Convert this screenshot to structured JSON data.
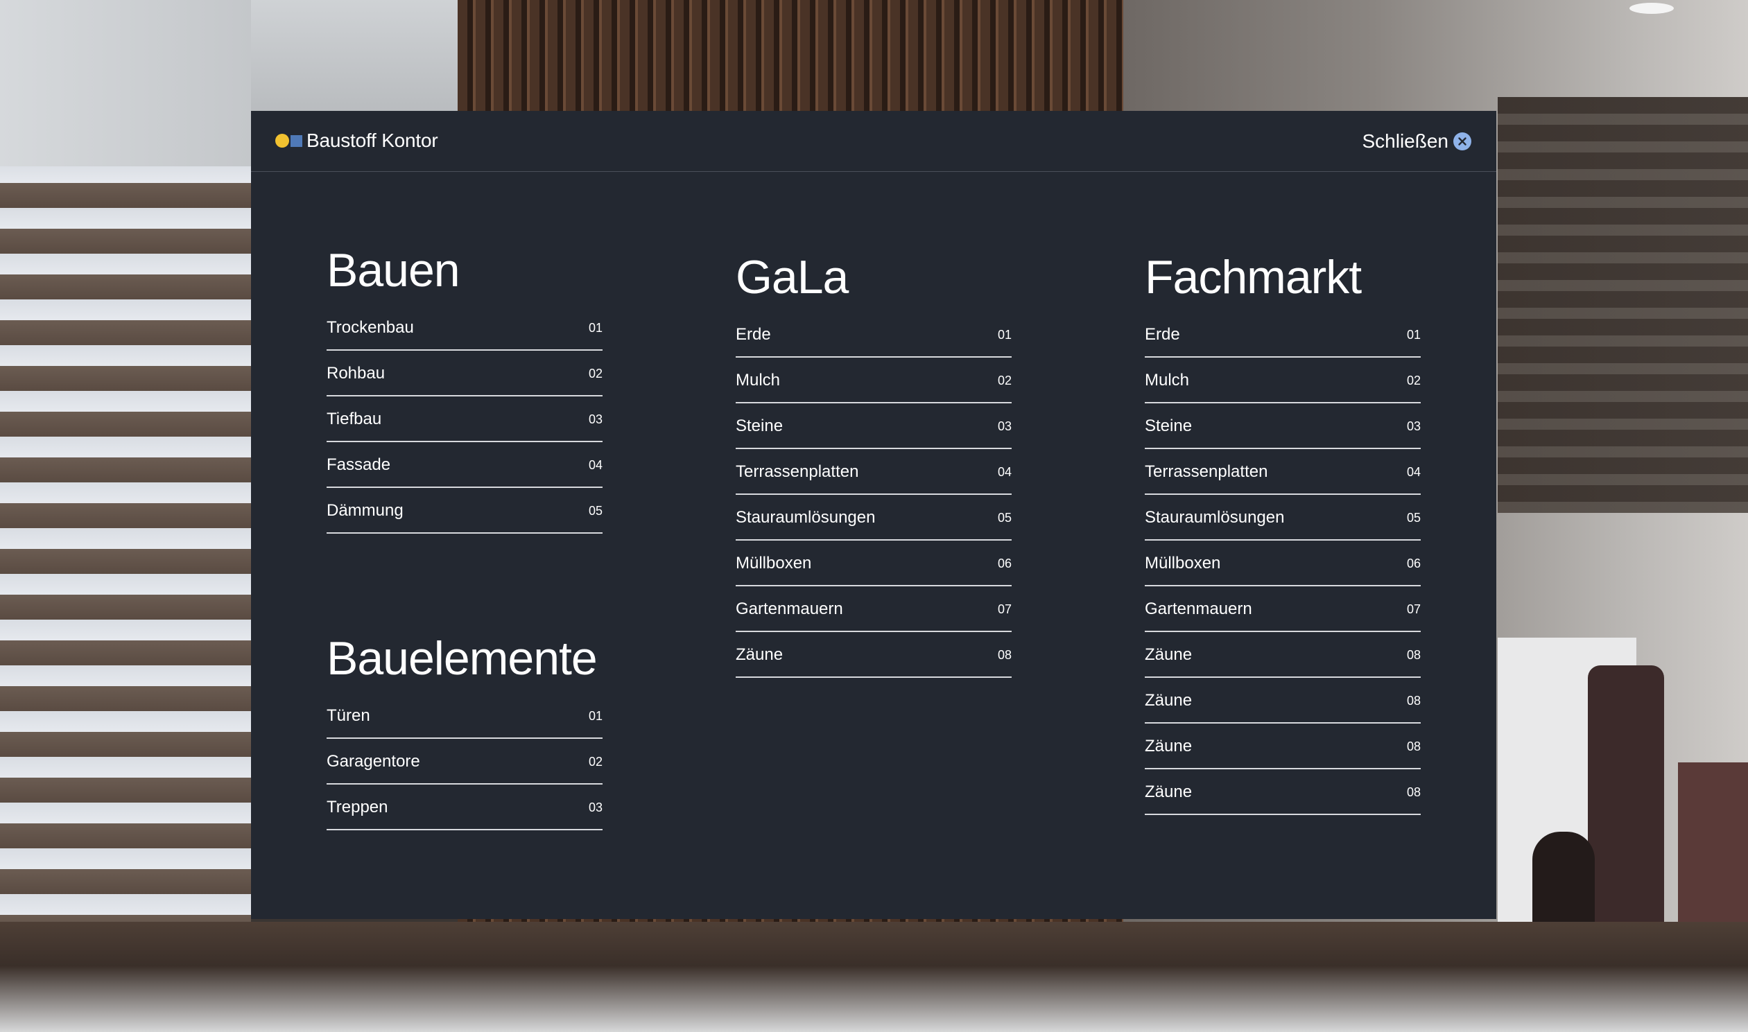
{
  "brand": {
    "name": "Baustoff Kontor",
    "dot_color": "#f2c230",
    "square_color": "#4f79b7"
  },
  "close": {
    "label": "Schließen",
    "icon": "close-circle-icon",
    "icon_color": "#8fb3ea"
  },
  "colors": {
    "panel": "#232831",
    "divider": "#d8dade"
  },
  "menu": {
    "bauen": {
      "title": "Bauen",
      "items": [
        {
          "label": "Trockenbau",
          "num": "01"
        },
        {
          "label": "Rohbau",
          "num": "02"
        },
        {
          "label": "Tiefbau",
          "num": "03"
        },
        {
          "label": "Fassade",
          "num": "04"
        },
        {
          "label": "Dämmung",
          "num": "05"
        }
      ]
    },
    "bauelemente": {
      "title": "Bauelemente",
      "items": [
        {
          "label": "Türen",
          "num": "01"
        },
        {
          "label": "Garagentore",
          "num": "02"
        },
        {
          "label": "Treppen",
          "num": "03"
        }
      ]
    },
    "gala": {
      "title": "GaLa",
      "items": [
        {
          "label": "Erde",
          "num": "01"
        },
        {
          "label": "Mulch",
          "num": "02"
        },
        {
          "label": "Steine",
          "num": "03"
        },
        {
          "label": "Terrassenplatten",
          "num": "04"
        },
        {
          "label": "Stauraumlösungen",
          "num": "05"
        },
        {
          "label": "Müllboxen",
          "num": "06"
        },
        {
          "label": "Gartenmauern",
          "num": "07"
        },
        {
          "label": "Zäune",
          "num": "08"
        }
      ]
    },
    "fachmarkt": {
      "title": "Fachmarkt",
      "items": [
        {
          "label": "Erde",
          "num": "01"
        },
        {
          "label": "Mulch",
          "num": "02"
        },
        {
          "label": "Steine",
          "num": "03"
        },
        {
          "label": "Terrassenplatten",
          "num": "04"
        },
        {
          "label": "Stauraumlösungen",
          "num": "05"
        },
        {
          "label": "Müllboxen",
          "num": "06"
        },
        {
          "label": "Gartenmauern",
          "num": "07"
        },
        {
          "label": "Zäune",
          "num": "08"
        },
        {
          "label": "Zäune",
          "num": "08"
        },
        {
          "label": "Zäune",
          "num": "08"
        },
        {
          "label": "Zäune",
          "num": "08"
        }
      ]
    }
  }
}
